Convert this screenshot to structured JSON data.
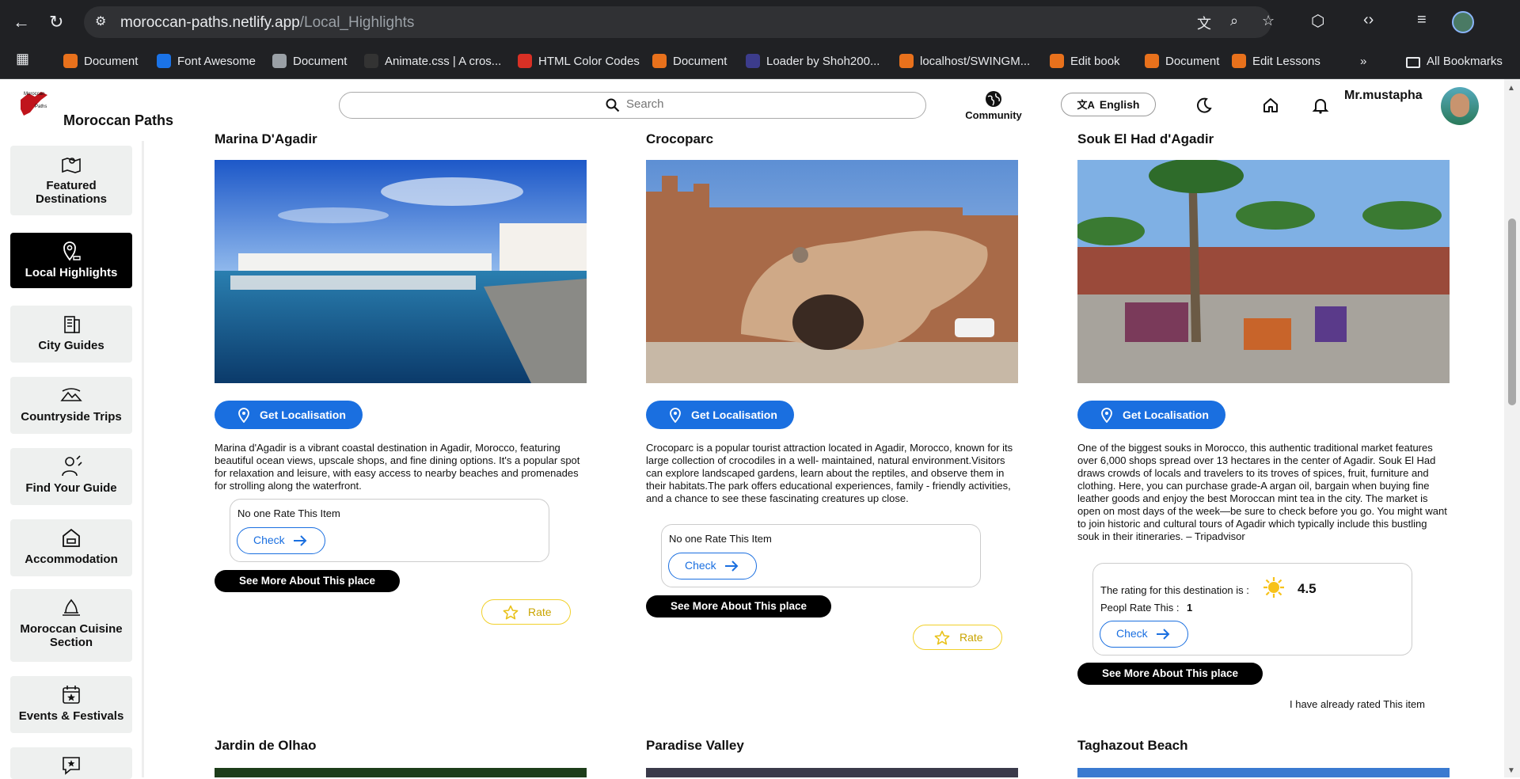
{
  "browser": {
    "url_host": "moroccan-paths.netlify.app",
    "url_path": "/Local_Highlights",
    "bookmarks": [
      {
        "label": "Document",
        "color": "#e8711c"
      },
      {
        "label": "Font Awesome",
        "color": "#1a73e8"
      },
      {
        "label": "Document",
        "color": "#9aa0a6"
      },
      {
        "label": "Animate.css | A cros...",
        "color": "#333333"
      },
      {
        "label": "HTML Color Codes",
        "color": "#d93025"
      },
      {
        "label": "Document",
        "color": "#e8711c"
      },
      {
        "label": "Loader by Shoh200...",
        "color": "#3c3c8c"
      },
      {
        "label": "localhost/SWINGM...",
        "color": "#e8711c"
      },
      {
        "label": "Edit book",
        "color": "#e8711c"
      },
      {
        "label": "Document",
        "color": "#e8711c"
      },
      {
        "label": "Edit Lessons",
        "color": "#e8711c"
      }
    ],
    "all_bookmarks": "All Bookmarks",
    "more": "»"
  },
  "header": {
    "brand": "Moroccan Paths",
    "search_placeholder": "Search",
    "community": "Community",
    "language": "English",
    "username": "Mr.mustapha"
  },
  "sidebar": {
    "items": [
      {
        "label": "Featured Destinations",
        "active": false
      },
      {
        "label": "Local Highlights",
        "active": true
      },
      {
        "label": "City Guides",
        "active": false
      },
      {
        "label": "Countryside Trips",
        "active": false
      },
      {
        "label": "Find Your Guide",
        "active": false
      },
      {
        "label": "Accommodation",
        "active": false
      },
      {
        "label": "Moroccan Cuisine Section",
        "active": false
      },
      {
        "label": "Events & Festivals",
        "active": false
      }
    ]
  },
  "cards": [
    {
      "title": "Marina D'Agadir",
      "loc_label": "Get Localisation",
      "description": "Marina d'Agadir is a vibrant coastal destination in Agadir, Morocco, featuring beautiful ocean views, upscale shops, and fine dining options. It's a popular spot for relaxation and leisure, with easy access to nearby beaches and promenades for strolling along the waterfront.",
      "rating_text": "No one Rate This Item",
      "check": "Check",
      "see_more": "See More About This place",
      "rate": "Rate"
    },
    {
      "title": "Crocoparc",
      "loc_label": "Get Localisation",
      "description": "Crocoparc is a popular tourist attraction located in Agadir, Morocco, known for its large collection of crocodiles in a well- maintained, natural environment.Visitors can explore landscaped gardens, learn about the reptiles, and observe them in their habitats.The park offers educational experiences, family - friendly activities, and a chance to see these fascinating creatures up close.",
      "rating_text": "No one Rate This Item",
      "check": "Check",
      "see_more": "See More About This place",
      "rate": "Rate"
    },
    {
      "title": "Souk El Had d'Agadir",
      "loc_label": "Get Localisation",
      "description": "One of the biggest souks in Morocco, this authentic traditional market features over 6,000 shops spread over 13 hectares in the center of Agadir. Souk El Had draws crowds of locals and travelers to its troves of spices, fruit, furniture and clothing. Here, you can purchase grade-A argan oil, bargain when buying fine leather goods and enjoy the best Moroccan mint tea in the city. The market is open on most days of the week—be sure to check before you go. You might want to join historic and cultural tours of Agadir which typically include this bustling souk in their itineraries. – Tripadvisor",
      "rating_label": "The rating for this destination is :",
      "rating_value": "4.5",
      "people_label": "Peopl Rate This :",
      "people_count": "1",
      "check": "Check",
      "see_more": "See More About This place",
      "already": "I have already rated This item"
    }
  ],
  "next_row": [
    "Jardin de Olhao",
    "Paradise Valley",
    "Taghazout Beach"
  ]
}
